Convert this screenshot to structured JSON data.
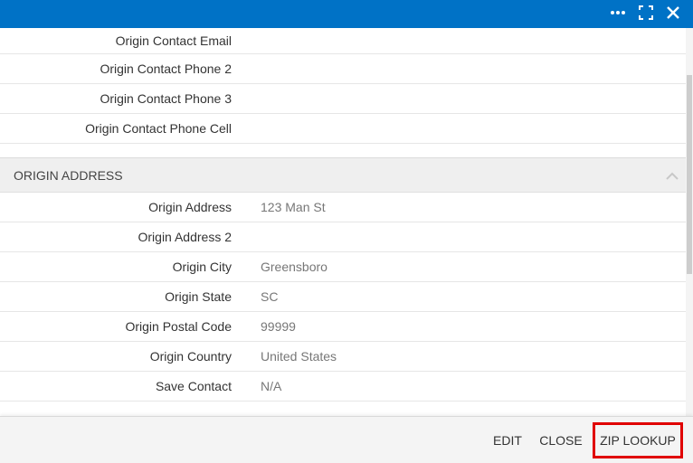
{
  "window": {
    "icons": [
      "more-icon",
      "fullscreen-icon",
      "close-icon"
    ]
  },
  "contact_rows": [
    {
      "label": "Origin Contact Email",
      "value": ""
    },
    {
      "label": "Origin Contact Phone 2",
      "value": ""
    },
    {
      "label": "Origin Contact Phone 3",
      "value": ""
    },
    {
      "label": "Origin Contact Phone Cell",
      "value": ""
    }
  ],
  "origin_address": {
    "section_title": "ORIGIN ADDRESS",
    "rows": [
      {
        "label": "Origin Address",
        "value": "123 Man St"
      },
      {
        "label": "Origin Address 2",
        "value": ""
      },
      {
        "label": "Origin City",
        "value": "Greensboro"
      },
      {
        "label": "Origin State",
        "value": "SC"
      },
      {
        "label": "Origin Postal Code",
        "value": "99999"
      },
      {
        "label": "Origin Country",
        "value": "United States"
      },
      {
        "label": "Save Contact",
        "value": "N/A"
      }
    ]
  },
  "footer": {
    "edit_label": "EDIT",
    "close_label": "CLOSE",
    "zip_lookup_label": "ZIP LOOKUP"
  },
  "colors": {
    "titlebar": "#0072c6",
    "highlight_border": "#e00000"
  }
}
